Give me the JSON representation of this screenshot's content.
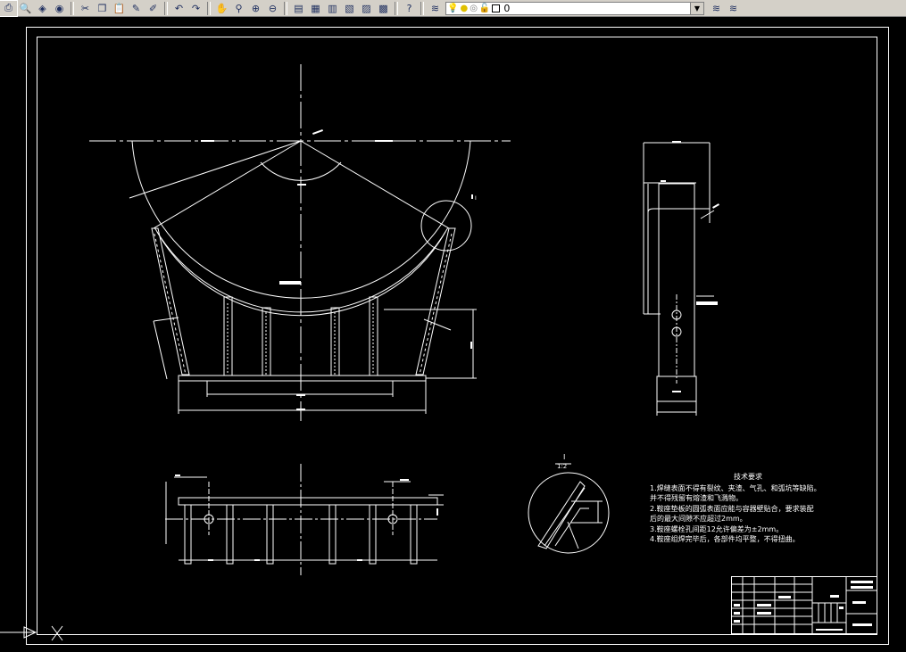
{
  "toolbar": {
    "buttons": [
      {
        "name": "publish-icon",
        "glyph": "⎙"
      },
      {
        "name": "plot-preview-icon",
        "glyph": "🔍"
      },
      {
        "name": "publish-web-icon",
        "glyph": "◈"
      },
      {
        "name": "etransmit-icon",
        "glyph": "◉"
      },
      {
        "name": "cut-icon",
        "glyph": "✂"
      },
      {
        "name": "copy-icon",
        "glyph": "❐"
      },
      {
        "name": "paste-icon",
        "glyph": "📋"
      },
      {
        "name": "match-properties-icon",
        "glyph": "✎"
      },
      {
        "name": "block-editor-icon",
        "glyph": "✐"
      },
      {
        "name": "undo-icon",
        "glyph": "↶"
      },
      {
        "name": "redo-icon",
        "glyph": "↷"
      },
      {
        "name": "pan-icon",
        "glyph": "✋"
      },
      {
        "name": "zoom-realtime-icon",
        "glyph": "⚲"
      },
      {
        "name": "zoom-window-icon",
        "glyph": "⊕"
      },
      {
        "name": "zoom-previous-icon",
        "glyph": "⊖"
      },
      {
        "name": "properties-icon",
        "glyph": "▤"
      },
      {
        "name": "design-center-icon",
        "glyph": "▦"
      },
      {
        "name": "tool-palettes-icon",
        "glyph": "▥"
      },
      {
        "name": "sheet-set-icon",
        "glyph": "▧"
      },
      {
        "name": "markup-icon",
        "glyph": "▨"
      },
      {
        "name": "calculator-icon",
        "glyph": "▩"
      },
      {
        "name": "help-icon",
        "glyph": "?"
      },
      {
        "name": "layer-manager-icon",
        "glyph": "≋"
      }
    ],
    "layer_value": "0",
    "right_buttons": [
      {
        "name": "make-layer-current-icon",
        "glyph": "≋"
      },
      {
        "name": "layer-previous-icon",
        "glyph": "≋"
      }
    ]
  },
  "drawing": {
    "detail_label": "I",
    "detail_scale": "1:2",
    "tech_title": "技术要求",
    "tech_lines": [
      "1.焊缝表面不得有裂纹、夹渣、气孔、和弧坑等缺陷。",
      "并不得残留有熔渣和飞溅物。",
      "2.鞍座垫板的圆弧表面应能与容器壁贴合，要求装配",
      "后的最大间隙不应超过2mm。",
      "3.鞍座螺栓孔间距12允许偏差为±2mm。",
      "4.鞍座组焊完毕后，各部件均平整，不得扭曲。"
    ]
  },
  "colors": {
    "background": "#000000",
    "line": "#ffffff",
    "toolbar": "#d4d0c8"
  }
}
